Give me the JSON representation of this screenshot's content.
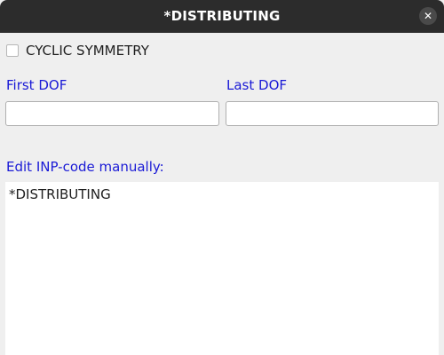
{
  "window": {
    "title": "*DISTRIBUTING",
    "close_icon": "close-icon"
  },
  "options": {
    "cyclic_symmetry_label": "CYCLIC SYMMETRY",
    "cyclic_symmetry_checked": false
  },
  "dof": {
    "first_label": "First DOF",
    "first_value": "",
    "last_label": "Last DOF",
    "last_value": ""
  },
  "editor": {
    "label": "Edit INP-code manually:",
    "content": "*DISTRIBUTING"
  },
  "colors": {
    "titlebar": "#2c2c2c",
    "background": "#efefef",
    "label_blue": "#1a1ad6"
  }
}
